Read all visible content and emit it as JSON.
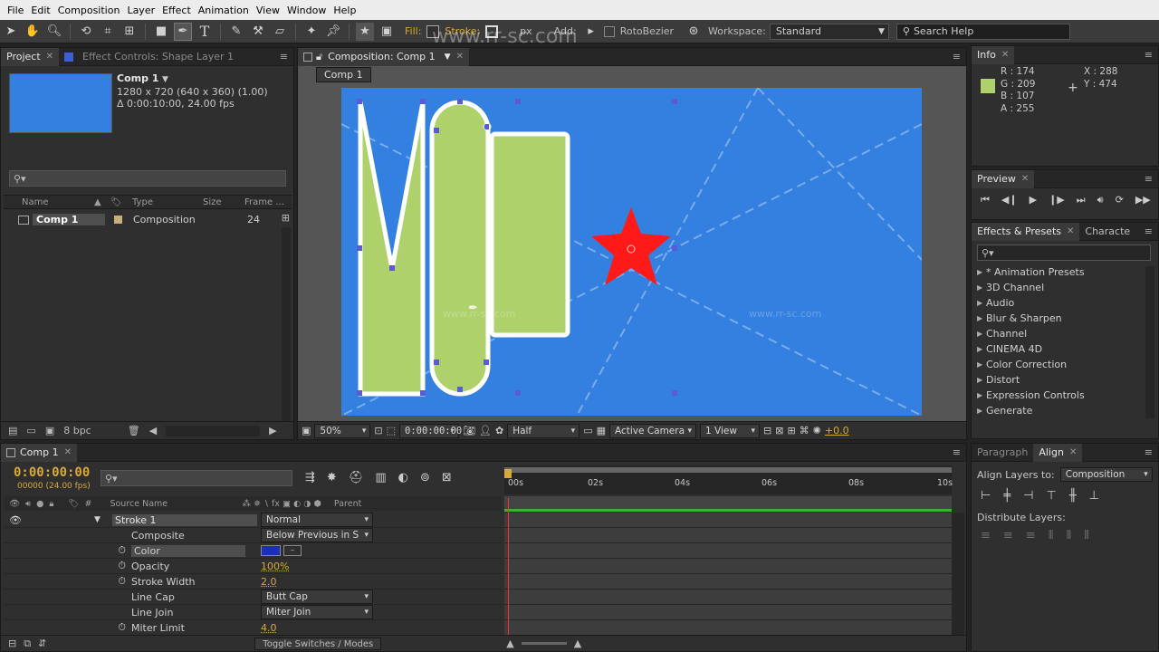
{
  "menu": [
    "File",
    "Edit",
    "Composition",
    "Layer",
    "Effect",
    "Animation",
    "View",
    "Window",
    "Help"
  ],
  "toolbar": {
    "fill_label": "Fill:",
    "stroke_label": "Stroke:",
    "px_label": "px",
    "add_label": "Add:",
    "rotobezier_label": "RotoBezier",
    "workspace_label": "Workspace:",
    "workspace_value": "Standard",
    "search_placeholder": "Search Help"
  },
  "watermark": "www.rr-sc.com",
  "project": {
    "tab_project": "Project",
    "tab_effect_controls": "Effect Controls: Shape Layer 1",
    "comp_name": "Comp 1",
    "comp_dims": "1280 x 720  (640 x 360) (1.00)",
    "comp_duration": "Δ 0:00:10:00, 24.00 fps",
    "col_name": "Name",
    "col_type": "Type",
    "col_size": "Size",
    "col_frame": "Frame ...",
    "row_name": "Comp 1",
    "row_type": "Composition",
    "row_frames": "24",
    "bpc": "8 bpc"
  },
  "composition": {
    "tab_label": "Composition: Comp 1",
    "sub_tab": "Comp 1",
    "zoom": "50%",
    "timecode": "0:00:00:00",
    "resolution": "Half",
    "camera": "Active Camera",
    "view": "1 View",
    "exposure": "+0.0"
  },
  "info": {
    "tab": "Info",
    "r": "R : 174",
    "g": "G : 209",
    "b": "B : 107",
    "a": "A : 255",
    "x": "X : 288",
    "y": "Y : 474",
    "swatch_color": "#aed16b"
  },
  "preview": {
    "tab": "Preview"
  },
  "effects": {
    "tab": "Effects & Presets",
    "tab2": "Characte",
    "items": [
      "* Animation Presets",
      "3D Channel",
      "Audio",
      "Blur & Sharpen",
      "Channel",
      "CINEMA 4D",
      "Color Correction",
      "Distort",
      "Expression Controls",
      "Generate"
    ]
  },
  "align": {
    "tab_paragraph": "Paragraph",
    "tab_align": "Align",
    "align_layers_to": "Align Layers to:",
    "align_target": "Composition",
    "distribute": "Distribute Layers:"
  },
  "timeline": {
    "tab": "Comp 1",
    "timecode": "0:00:00:00",
    "frames": "00000 (24.00 fps)",
    "col_source": "Source Name",
    "col_parent": "Parent",
    "ruler": [
      "00s",
      "02s",
      "04s",
      "06s",
      "08s",
      "10s"
    ],
    "toggle": "Toggle Switches / Modes",
    "props": [
      {
        "name": "Stroke 1",
        "value": "Normal",
        "kind": "dropdown"
      },
      {
        "name": "Composite",
        "value": "Below Previous in S",
        "kind": "dropdown"
      },
      {
        "name": "Color",
        "value": "",
        "kind": "color"
      },
      {
        "name": "Opacity",
        "value": "100%",
        "kind": "number"
      },
      {
        "name": "Stroke Width",
        "value": "2.0",
        "kind": "number"
      },
      {
        "name": "Line Cap",
        "value": "Butt Cap",
        "kind": "dropdown"
      },
      {
        "name": "Line Join",
        "value": "Miter Join",
        "kind": "dropdown"
      },
      {
        "name": "Miter Limit",
        "value": "4.0",
        "kind": "number"
      }
    ]
  },
  "colors": {
    "comp_bg": "#3380e0",
    "shape_fill": "#aed16b",
    "star": "#ff1a1a",
    "accent": "#d7a93a",
    "stroke_color": "#1c2fb8"
  }
}
